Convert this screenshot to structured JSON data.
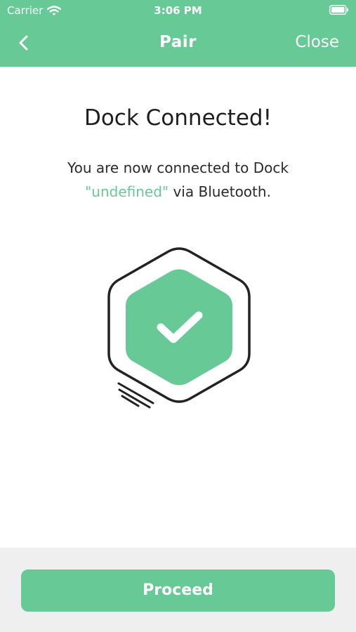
{
  "status_bar": {
    "carrier": "Carrier",
    "time": "3:06 PM"
  },
  "nav": {
    "title": "Pair",
    "close_label": "Close",
    "back_icon": "chevron-left-icon"
  },
  "content": {
    "title": "Dock Connected!",
    "message_line1": "You are now connected to Dock",
    "device_name": "\"undefined\"",
    "message_suffix": " via Bluetooth.",
    "illustration_icon": "hexagon-check-icon"
  },
  "footer": {
    "proceed_label": "Proceed"
  },
  "colors": {
    "accent": "#67c995",
    "footer_bg": "#efefef",
    "text": "#1e1e1e"
  }
}
